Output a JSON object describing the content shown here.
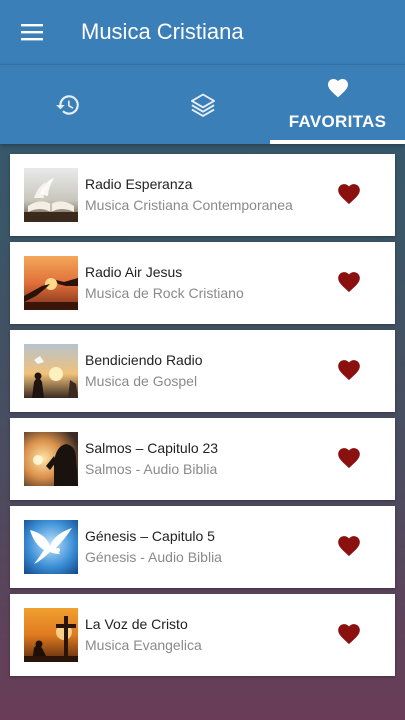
{
  "app": {
    "title": "Musica Cristiana"
  },
  "tabs": {
    "history_icon": "history-icon",
    "layers_icon": "layers-icon",
    "favorites_icon": "heart-icon",
    "favorites_label": "FAVORITAS",
    "active": "favorites"
  },
  "colors": {
    "app_bar": "#3b7fb8",
    "heart": "#8b1010",
    "title_text": "#222222",
    "subtitle_text": "#8a8a8a"
  },
  "favorites": [
    {
      "title": "Radio Esperanza",
      "subtitle": "Musica Cristiana Contemporanea",
      "image": "open-bible-image"
    },
    {
      "title": "Radio Air Jesus",
      "subtitle": "Musica de Rock Cristiano",
      "image": "reaching-hands-sunset-image"
    },
    {
      "title": "Bendiciendo Radio",
      "subtitle": "Musica de Gospel",
      "image": "worship-sunset-image"
    },
    {
      "title": "Salmos – Capitulo 23",
      "subtitle": "Salmos - Audio Biblia",
      "image": "praying-silhouette-image"
    },
    {
      "title": "Génesis – Capitulo 5",
      "subtitle": "Génesis - Audio Biblia",
      "image": "white-dove-image"
    },
    {
      "title": "La Voz de Cristo",
      "subtitle": "Musica Evangelica",
      "image": "cross-sunset-image"
    }
  ]
}
